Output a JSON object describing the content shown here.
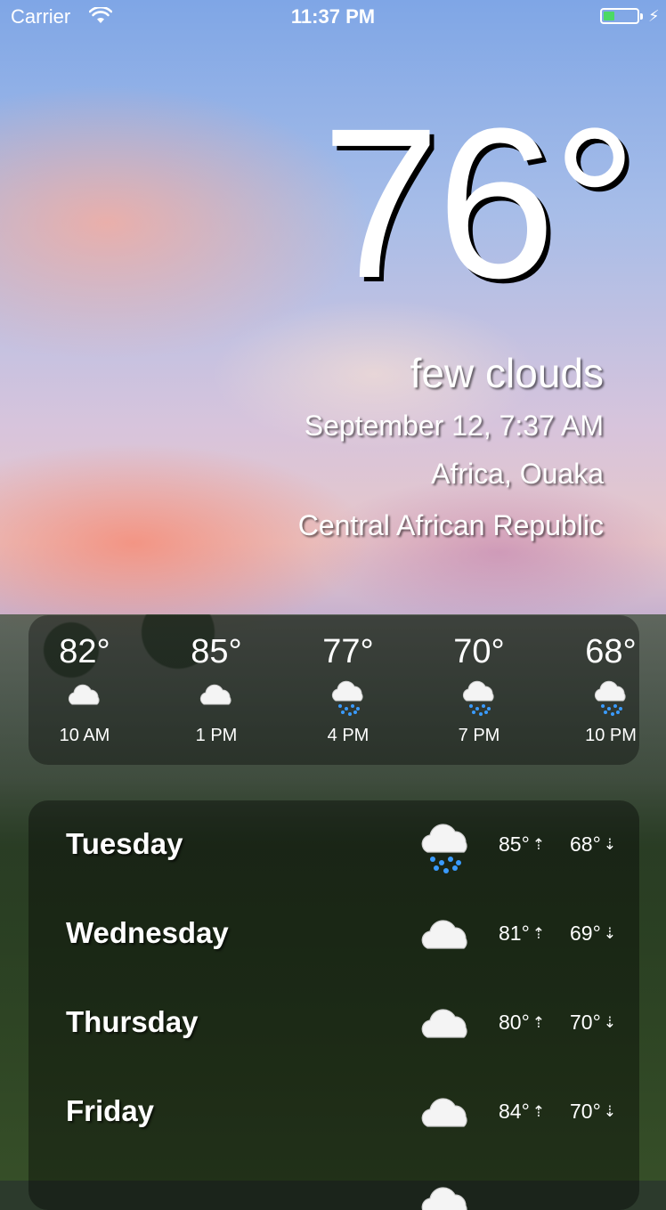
{
  "status_bar": {
    "carrier": "Carrier",
    "time": "11:37 PM",
    "battery_color": "#4cd964"
  },
  "current": {
    "temperature": "76°",
    "description": "few clouds",
    "datetime": "September 12, 7:37 AM",
    "location_line1": "Africa, Ouaka",
    "location_line2": "Central African Republic"
  },
  "hourly": [
    {
      "temp": "82°",
      "time": "10 AM",
      "icon": "cloud-icon"
    },
    {
      "temp": "85°",
      "time": "1 PM",
      "icon": "cloud-icon"
    },
    {
      "temp": "77°",
      "time": "4 PM",
      "icon": "rain-cloud-icon"
    },
    {
      "temp": "70°",
      "time": "7 PM",
      "icon": "rain-cloud-icon"
    },
    {
      "temp": "68°",
      "time": "10 PM",
      "icon": "rain-cloud-icon"
    }
  ],
  "daily": [
    {
      "day": "Tuesday",
      "high": "85°",
      "low": "68°",
      "icon": "rain-cloud-icon"
    },
    {
      "day": "Wednesday",
      "high": "81°",
      "low": "69°",
      "icon": "cloud-icon"
    },
    {
      "day": "Thursday",
      "high": "80°",
      "low": "70°",
      "icon": "cloud-icon"
    },
    {
      "day": "Friday",
      "high": "84°",
      "low": "70°",
      "icon": "cloud-icon"
    }
  ]
}
